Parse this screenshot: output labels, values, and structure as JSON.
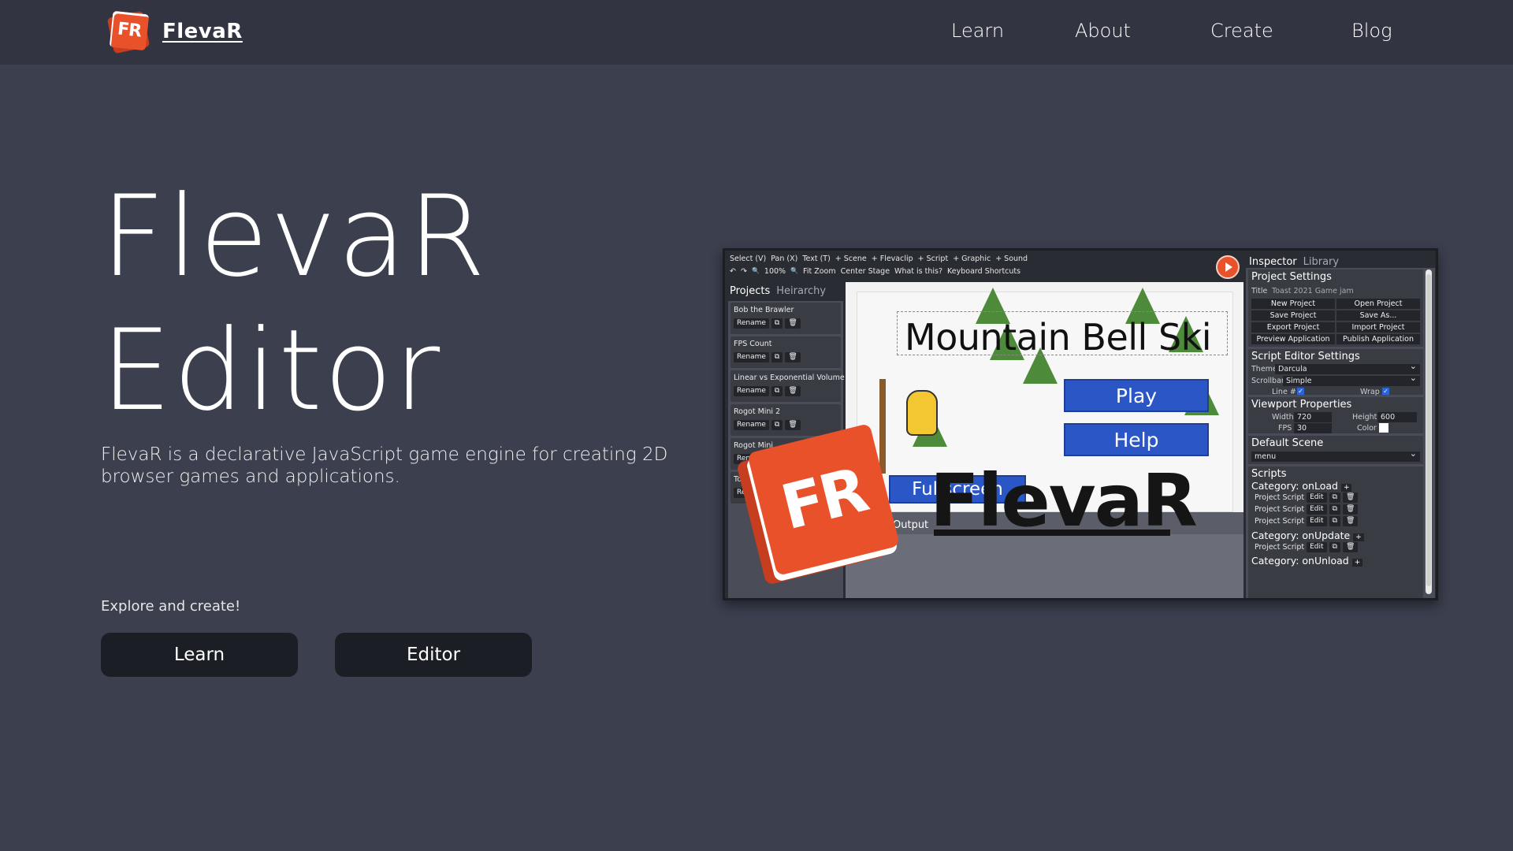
{
  "nav": {
    "brand_logo_text": "FR",
    "brand_name": "FlevaR",
    "links": [
      "Learn",
      "About",
      "Create",
      "Blog"
    ]
  },
  "hero": {
    "title_line1": "FlevaR",
    "title_line2": "Editor",
    "description": "FlevaR is a declarative JavaScript game engine for creating 2D browser games and applications.",
    "explore": "Explore and create!",
    "buttons": [
      "Learn",
      "Editor"
    ]
  },
  "editor_screenshot": {
    "toolbar_row1": [
      "Select (V)",
      "Pan (X)",
      "Text (T)",
      "+ Scene",
      "+ Flevaclip",
      "+ Script",
      "+ Graphic",
      "+ Sound"
    ],
    "toolbar_row2": [
      "↶",
      "↷",
      "🔍",
      "100%",
      "🔍",
      "Fit Zoom",
      "Center Stage",
      "What is this?",
      "Keyboard Shortcuts"
    ],
    "left_tabs": [
      "Projects",
      "Heirarchy"
    ],
    "projects": [
      {
        "name": "Bob the Brawler",
        "rename": "Rename"
      },
      {
        "name": "FPS Count",
        "rename": "Rename"
      },
      {
        "name": "Linear vs Exponential Volume",
        "rename": "Rename"
      },
      {
        "name": "Rogot Mini 2",
        "rename": "Rename"
      },
      {
        "name": "Rogot Mini",
        "rename": "Rename"
      },
      {
        "name": "Toast",
        "rename": "Rename"
      }
    ],
    "stage": {
      "game_title": "Mountain Bell Ski",
      "play": "Play",
      "help": "Help",
      "fullscreen": "Fullscreen",
      "output_label": "Output"
    },
    "right_tabs": [
      "Inspector",
      "Library"
    ],
    "project_settings": {
      "title": "Project Settings",
      "title_label": "Title",
      "title_value": "Toast 2021 Game jam",
      "buttons": [
        "New Project",
        "Open Project",
        "Save Project",
        "Save As...",
        "Export Project",
        "Import Project",
        "Preview Application",
        "Publish Application"
      ]
    },
    "script_editor_settings": {
      "title": "Script Editor Settings",
      "theme_label": "Theme",
      "theme_value": "Darcula",
      "scrollbar_label": "Scrollbar",
      "scrollbar_value": "Simple",
      "line_label": "Line #",
      "wrap_label": "Wrap"
    },
    "viewport": {
      "title": "Viewport Properties",
      "width_label": "Width",
      "width_value": "720",
      "height_label": "Height",
      "height_value": "600",
      "fps_label": "FPS",
      "fps_value": "30",
      "color_label": "Color"
    },
    "default_scene": {
      "title": "Default Scene",
      "value": "menu"
    },
    "scripts": {
      "title": "Scripts",
      "cat_onload": "Category: onLoad",
      "cat_onupdate": "Category: onUpdate",
      "cat_onunload": "Category: onUnload",
      "script_label": "Project Script",
      "edit": "Edit"
    },
    "overlay_logo_text": "FR",
    "overlay_word": "FlevaR"
  },
  "colors": {
    "background": "#3b3f4e",
    "nav": "#323541",
    "button": "#1c1e26",
    "brand_orange": "#e8512a",
    "game_button_blue": "#2a56c6"
  }
}
